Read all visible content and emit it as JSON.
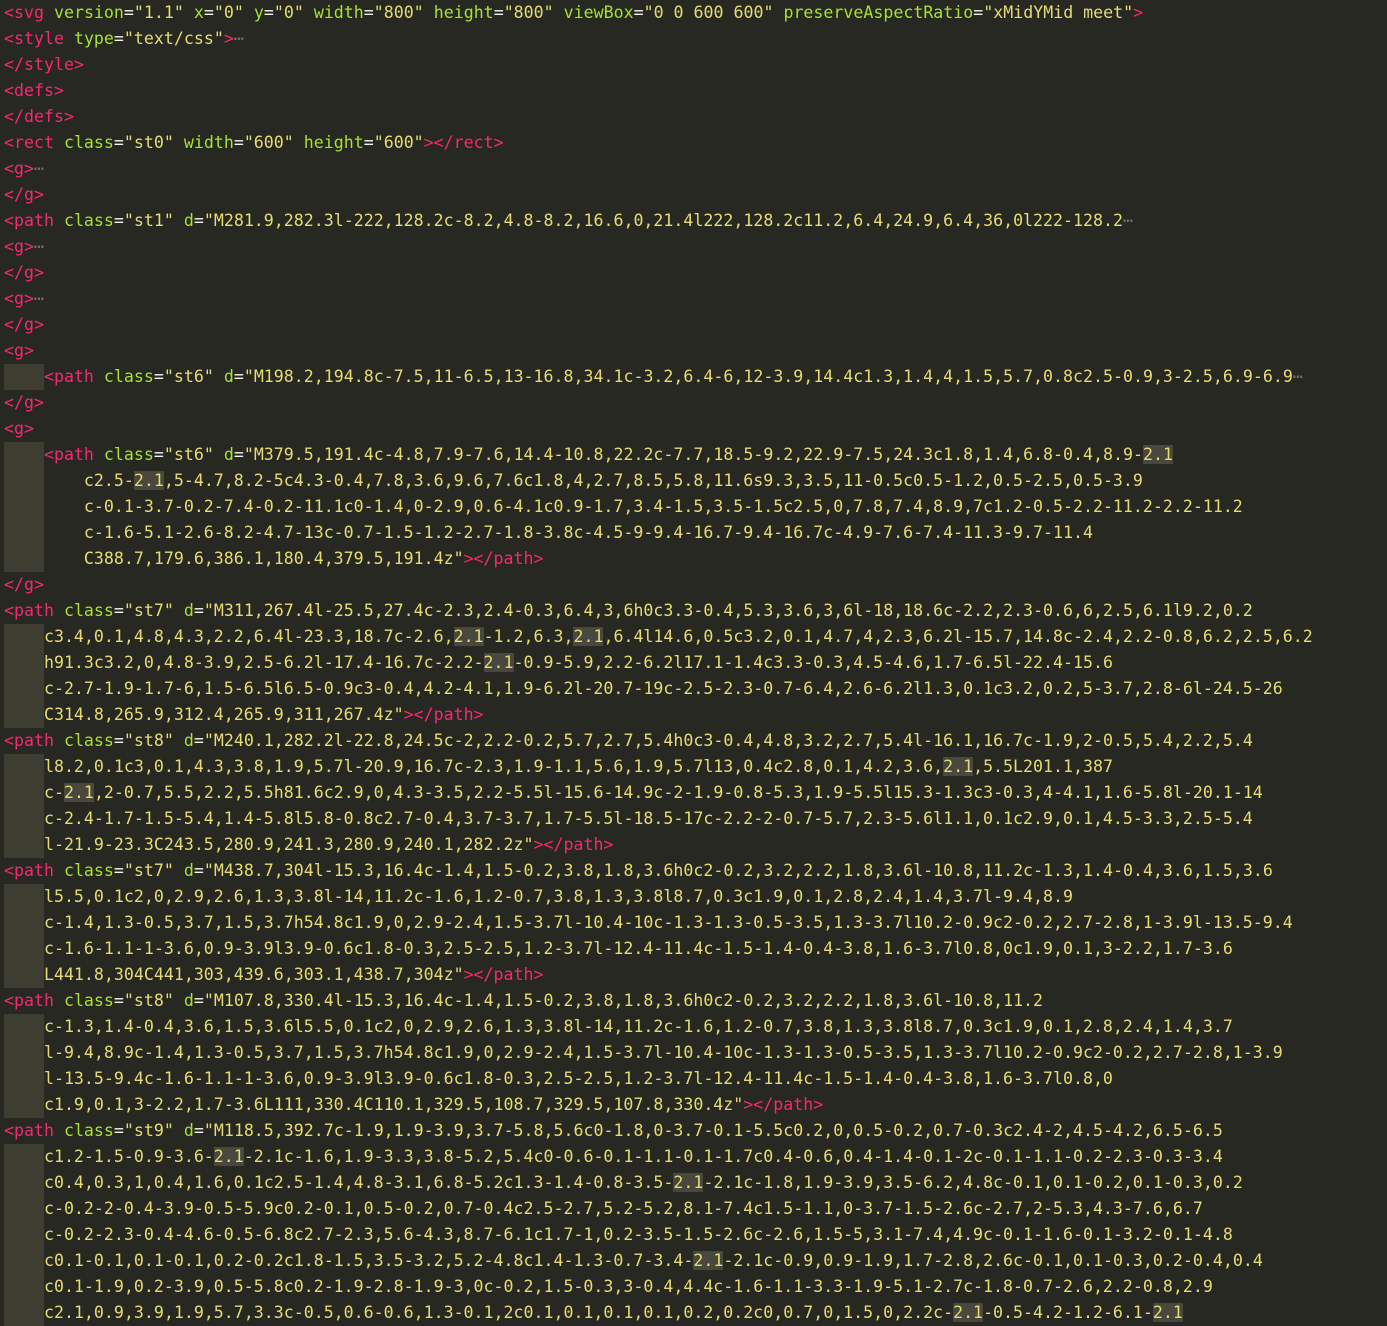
{
  "editor": {
    "lines": [
      [
        [
          "t",
          "<svg"
        ],
        [
          "p",
          " "
        ],
        [
          "a",
          "version"
        ],
        [
          "p",
          "="
        ],
        [
          "s",
          "\"1.1\""
        ],
        [
          "p",
          " "
        ],
        [
          "a",
          "x"
        ],
        [
          "p",
          "="
        ],
        [
          "s",
          "\"0\""
        ],
        [
          "p",
          " "
        ],
        [
          "a",
          "y"
        ],
        [
          "p",
          "="
        ],
        [
          "s",
          "\"0\""
        ],
        [
          "p",
          " "
        ],
        [
          "a",
          "width"
        ],
        [
          "p",
          "="
        ],
        [
          "s",
          "\"800\""
        ],
        [
          "p",
          " "
        ],
        [
          "a",
          "height"
        ],
        [
          "p",
          "="
        ],
        [
          "s",
          "\"800\""
        ],
        [
          "p",
          " "
        ],
        [
          "a",
          "viewBox"
        ],
        [
          "p",
          "="
        ],
        [
          "s",
          "\"0 0 600 600\""
        ],
        [
          "p",
          " "
        ],
        [
          "a",
          "preserveAspectRatio"
        ],
        [
          "p",
          "="
        ],
        [
          "s",
          "\"xMidYMid meet\""
        ],
        [
          "t",
          ">"
        ]
      ],
      [
        [
          "t",
          "<style"
        ],
        [
          "p",
          " "
        ],
        [
          "a",
          "type"
        ],
        [
          "p",
          "="
        ],
        [
          "s",
          "\"text/css\""
        ],
        [
          "t",
          ">"
        ],
        [
          "f",
          "⋯"
        ]
      ],
      [
        [
          "t",
          "</style>"
        ]
      ],
      [
        [
          "t",
          "<defs>"
        ]
      ],
      [
        [
          "t",
          "</defs>"
        ]
      ],
      [
        [
          "t",
          "<rect"
        ],
        [
          "p",
          " "
        ],
        [
          "a",
          "class"
        ],
        [
          "p",
          "="
        ],
        [
          "s",
          "\"st0\""
        ],
        [
          "p",
          " "
        ],
        [
          "a",
          "width"
        ],
        [
          "p",
          "="
        ],
        [
          "s",
          "\"600\""
        ],
        [
          "p",
          " "
        ],
        [
          "a",
          "height"
        ],
        [
          "p",
          "="
        ],
        [
          "s",
          "\"600\""
        ],
        [
          "t",
          "></rect>"
        ]
      ],
      [
        [
          "t",
          "<g>"
        ],
        [
          "f",
          "⋯"
        ]
      ],
      [
        [
          "t",
          "</g>"
        ]
      ],
      [
        [
          "t",
          "<path"
        ],
        [
          "p",
          " "
        ],
        [
          "a",
          "class"
        ],
        [
          "p",
          "="
        ],
        [
          "s",
          "\"st1\""
        ],
        [
          "p",
          " "
        ],
        [
          "a",
          "d"
        ],
        [
          "p",
          "="
        ],
        [
          "s",
          "\"M281.9,282.3l-222,128.2c-8.2,4.8-8.2,16.6,0,21.4l222,128.2c11.2,6.4,24.9,6.4,36,0l222-128.2"
        ],
        [
          "f",
          "⋯"
        ]
      ],
      [
        [
          "t",
          "<g>"
        ],
        [
          "f",
          "⋯"
        ]
      ],
      [
        [
          "t",
          "</g>"
        ]
      ],
      [
        [
          "t",
          "<g>"
        ],
        [
          "f",
          "⋯"
        ]
      ],
      [
        [
          "t",
          "</g>"
        ]
      ],
      [
        [
          "t",
          "<g>"
        ]
      ],
      [
        [
          "p",
          "    "
        ],
        [
          "t",
          "<path"
        ],
        [
          "p",
          " "
        ],
        [
          "a",
          "class"
        ],
        [
          "p",
          "="
        ],
        [
          "s",
          "\"st6\""
        ],
        [
          "p",
          " "
        ],
        [
          "a",
          "d"
        ],
        [
          "p",
          "="
        ],
        [
          "s",
          "\"M198.2,194.8c-7.5,11-6.5,13-16.8,34.1c-3.2,6.4-6,12-3.9,14.4c1.3,1.4,4,1.5,5.7,0.8c2.5-0.9,3-2.5,6.9-6.9"
        ],
        [
          "f",
          "⋯"
        ]
      ],
      [
        [
          "t",
          "</g>"
        ]
      ],
      [
        [
          "t",
          "<g>"
        ]
      ],
      [
        [
          "p",
          "    "
        ],
        [
          "t",
          "<path"
        ],
        [
          "p",
          " "
        ],
        [
          "a",
          "class"
        ],
        [
          "p",
          "="
        ],
        [
          "s",
          "\"st6\""
        ],
        [
          "p",
          " "
        ],
        [
          "a",
          "d"
        ],
        [
          "p",
          "="
        ],
        [
          "s",
          "\"M379.5,191.4c-4.8,7.9-7.6,14.4-10.8,22.2c-7.7,18.5-9.2,22.9-7.5,24.3c1.8,1.4,6.8-0.4,8.9-"
        ],
        [
          "h",
          "2.1"
        ]
      ],
      [
        [
          "s",
          "        c2.5-"
        ],
        [
          "h",
          "2.1"
        ],
        [
          "s",
          ",5-4.7,8.2-5c4.3-0.4,7.8,3.6,9.6,7.6c1.8,4,2.7,8.5,5.8,11.6s9.3,3.5,11-0.5c0.5-1.2,0.5-2.5,0.5-3.9"
        ]
      ],
      [
        [
          "s",
          "        c-0.1-3.7-0.2-7.4-0.2-11.1c0-1.4,0-2.9,0.6-4.1c0.9-1.7,3.4-1.5,3.5-1.5c2.5,0,7.8,7.4,8.9,7c1.2-0.5-2.2-11.2-2.2-11.2"
        ]
      ],
      [
        [
          "s",
          "        c-1.6-5.1-2.6-8.2-4.7-13c-0.7-1.5-1.2-2.7-1.8-3.8c-4.5-9-9.4-16.7-9.4-16.7c-4.9-7.6-7.4-11.3-9.7-11.4"
        ]
      ],
      [
        [
          "s",
          "        C388.7,179.6,386.1,180.4,379.5,191.4z\""
        ],
        [
          "t",
          "></path>"
        ]
      ],
      [
        [
          "t",
          "</g>"
        ]
      ],
      [
        [
          "t",
          "<path"
        ],
        [
          "p",
          " "
        ],
        [
          "a",
          "class"
        ],
        [
          "p",
          "="
        ],
        [
          "s",
          "\"st7\""
        ],
        [
          "p",
          " "
        ],
        [
          "a",
          "d"
        ],
        [
          "p",
          "="
        ],
        [
          "s",
          "\"M311,267.4l-25.5,27.4c-2.3,2.4-0.3,6.4,3,6h0c3.3-0.4,5.3,3.6,3,6l-18,18.6c-2.2,2.3-0.6,6,2.5,6.1l9.2,0.2"
        ]
      ],
      [
        [
          "s",
          "    c3.4,0.1,4.8,4.3,2.2,6.4l-23.3,18.7c-2.6,"
        ],
        [
          "h",
          "2.1"
        ],
        [
          "s",
          "-1.2,6.3,"
        ],
        [
          "h",
          "2.1"
        ],
        [
          "s",
          ",6.4l14.6,0.5c3.2,0.1,4.7,4,2.3,6.2l-15.7,14.8c-2.4,2.2-0.8,6.2,2.5,6.2"
        ]
      ],
      [
        [
          "s",
          "    h91.3c3.2,0,4.8-3.9,2.5-6.2l-17.4-16.7c-2.2-"
        ],
        [
          "h",
          "2.1"
        ],
        [
          "s",
          "-0.9-5.9,2.2-6.2l17.1-1.4c3.3-0.3,4.5-4.6,1.7-6.5l-22.4-15.6"
        ]
      ],
      [
        [
          "s",
          "    c-2.7-1.9-1.7-6,1.5-6.5l6.5-0.9c3-0.4,4.2-4.1,1.9-6.2l-20.7-19c-2.5-2.3-0.7-6.4,2.6-6.2l1.3,0.1c3.2,0.2,5-3.7,2.8-6l-24.5-26"
        ]
      ],
      [
        [
          "s",
          "    C314.8,265.9,312.4,265.9,311,267.4z\""
        ],
        [
          "t",
          "></path>"
        ]
      ],
      [
        [
          "t",
          "<path"
        ],
        [
          "p",
          " "
        ],
        [
          "a",
          "class"
        ],
        [
          "p",
          "="
        ],
        [
          "s",
          "\"st8\""
        ],
        [
          "p",
          " "
        ],
        [
          "a",
          "d"
        ],
        [
          "p",
          "="
        ],
        [
          "s",
          "\"M240.1,282.2l-22.8,24.5c-2,2.2-0.2,5.7,2.7,5.4h0c3-0.4,4.8,3.2,2.7,5.4l-16.1,16.7c-1.9,2-0.5,5.4,2.2,5.4"
        ]
      ],
      [
        [
          "s",
          "    l8.2,0.1c3,0.1,4.3,3.8,1.9,5.7l-20.9,16.7c-2.3,1.9-1.1,5.6,1.9,5.7l13,0.4c2.8,0.1,4.2,3.6,"
        ],
        [
          "h",
          "2.1"
        ],
        [
          "s",
          ",5.5L201.1,387"
        ]
      ],
      [
        [
          "s",
          "    c-"
        ],
        [
          "h",
          "2.1"
        ],
        [
          "s",
          ",2-0.7,5.5,2.2,5.5h81.6c2.9,0,4.3-3.5,2.2-5.5l-15.6-14.9c-2-1.9-0.8-5.3,1.9-5.5l15.3-1.3c3-0.3,4-4.1,1.6-5.8l-20.1-14"
        ]
      ],
      [
        [
          "s",
          "    c-2.4-1.7-1.5-5.4,1.4-5.8l5.8-0.8c2.7-0.4,3.7-3.7,1.7-5.5l-18.5-17c-2.2-2-0.7-5.7,2.3-5.6l1.1,0.1c2.9,0.1,4.5-3.3,2.5-5.4"
        ]
      ],
      [
        [
          "s",
          "    l-21.9-23.3C243.5,280.9,241.3,280.9,240.1,282.2z\""
        ],
        [
          "t",
          "></path>"
        ]
      ],
      [
        [
          "t",
          "<path"
        ],
        [
          "p",
          " "
        ],
        [
          "a",
          "class"
        ],
        [
          "p",
          "="
        ],
        [
          "s",
          "\"st7\""
        ],
        [
          "p",
          " "
        ],
        [
          "a",
          "d"
        ],
        [
          "p",
          "="
        ],
        [
          "s",
          "\"M438.7,304l-15.3,16.4c-1.4,1.5-0.2,3.8,1.8,3.6h0c2-0.2,3.2,2.2,1.8,3.6l-10.8,11.2c-1.3,1.4-0.4,3.6,1.5,3.6"
        ]
      ],
      [
        [
          "s",
          "    l5.5,0.1c2,0,2.9,2.6,1.3,3.8l-14,11.2c-1.6,1.2-0.7,3.8,1.3,3.8l8.7,0.3c1.9,0.1,2.8,2.4,1.4,3.7l-9.4,8.9"
        ]
      ],
      [
        [
          "s",
          "    c-1.4,1.3-0.5,3.7,1.5,3.7h54.8c1.9,0,2.9-2.4,1.5-3.7l-10.4-10c-1.3-1.3-0.5-3.5,1.3-3.7l10.2-0.9c2-0.2,2.7-2.8,1-3.9l-13.5-9.4"
        ]
      ],
      [
        [
          "s",
          "    c-1.6-1.1-1-3.6,0.9-3.9l3.9-0.6c1.8-0.3,2.5-2.5,1.2-3.7l-12.4-11.4c-1.5-1.4-0.4-3.8,1.6-3.7l0.8,0c1.9,0.1,3-2.2,1.7-3.6"
        ]
      ],
      [
        [
          "s",
          "    L441.8,304C441,303,439.6,303.1,438.7,304z\""
        ],
        [
          "t",
          "></path>"
        ]
      ],
      [
        [
          "t",
          "<path"
        ],
        [
          "p",
          " "
        ],
        [
          "a",
          "class"
        ],
        [
          "p",
          "="
        ],
        [
          "s",
          "\"st8\""
        ],
        [
          "p",
          " "
        ],
        [
          "a",
          "d"
        ],
        [
          "p",
          "="
        ],
        [
          "s",
          "\"M107.8,330.4l-15.3,16.4c-1.4,1.5-0.2,3.8,1.8,3.6h0c2-0.2,3.2,2.2,1.8,3.6l-10.8,11.2"
        ]
      ],
      [
        [
          "s",
          "    c-1.3,1.4-0.4,3.6,1.5,3.6l5.5,0.1c2,0,2.9,2.6,1.3,3.8l-14,11.2c-1.6,1.2-0.7,3.8,1.3,3.8l8.7,0.3c1.9,0.1,2.8,2.4,1.4,3.7"
        ]
      ],
      [
        [
          "s",
          "    l-9.4,8.9c-1.4,1.3-0.5,3.7,1.5,3.7h54.8c1.9,0,2.9-2.4,1.5-3.7l-10.4-10c-1.3-1.3-0.5-3.5,1.3-3.7l10.2-0.9c2-0.2,2.7-2.8,1-3.9"
        ]
      ],
      [
        [
          "s",
          "    l-13.5-9.4c-1.6-1.1-1-3.6,0.9-3.9l3.9-0.6c1.8-0.3,2.5-2.5,1.2-3.7l-12.4-11.4c-1.5-1.4-0.4-3.8,1.6-3.7l0.8,0"
        ]
      ],
      [
        [
          "s",
          "    c1.9,0.1,3-2.2,1.7-3.6L111,330.4C110.1,329.5,108.7,329.5,107.8,330.4z\""
        ],
        [
          "t",
          "></path>"
        ]
      ],
      [
        [
          "t",
          "<path"
        ],
        [
          "p",
          " "
        ],
        [
          "a",
          "class"
        ],
        [
          "p",
          "="
        ],
        [
          "s",
          "\"st9\""
        ],
        [
          "p",
          " "
        ],
        [
          "a",
          "d"
        ],
        [
          "p",
          "="
        ],
        [
          "s",
          "\"M118.5,392.7c-1.9,1.9-3.9,3.7-5.8,5.6c0-1.8,0-3.7-0.1-5.5c0.2,0,0.5-0.2,0.7-0.3c2.4-2,4.5-4.2,6.5-6.5"
        ]
      ],
      [
        [
          "s",
          "    c1.2-1.5-0.9-3.6-"
        ],
        [
          "h",
          "2.1"
        ],
        [
          "s",
          "-2.1c-1.6,1.9-3.3,3.8-5.2,5.4c0-0.6-0.1-1.1-0.1-1.7c0.4-0.6,0.4-1.4-0.1-2c-0.1-1.1-0.2-2.3-0.3-3.4"
        ]
      ],
      [
        [
          "s",
          "    c0.4,0.3,1,0.4,1.6,0.1c2.5-1.4,4.8-3.1,6.8-5.2c1.3-1.4-0.8-3.5-"
        ],
        [
          "h",
          "2.1"
        ],
        [
          "s",
          "-2.1c-1.8,1.9-3.9,3.5-6.2,4.8c-0.1,0.1-0.2,0.1-0.3,0.2"
        ]
      ],
      [
        [
          "s",
          "    c-0.2-2-0.4-3.9-0.5-5.9c0.2-0.1,0.5-0.2,0.7-0.4c2.5-2.7,5.2-5.2,8.1-7.4c1.5-1.1,0-3.7-1.5-2.6c-2.7,2-5.3,4.3-7.6,6.7"
        ]
      ],
      [
        [
          "s",
          "    c-0.2-2.3-0.4-4.6-0.5-6.8c2.7-2.3,5.6-4.3,8.7-6.1c1.7-1,0.2-3.5-1.5-2.6c-2.6,1.5-5,3.1-7.4,4.9c-0.1-1.6-0.1-3.2-0.1-4.8"
        ]
      ],
      [
        [
          "s",
          "    c0.1-0.1,0.1-0.1,0.2-0.2c1.8-1.5,3.5-3.2,5.2-4.8c1.4-1.3-0.7-3.4-"
        ],
        [
          "h",
          "2.1"
        ],
        [
          "s",
          "-2.1c-0.9,0.9-1.9,1.7-2.8,2.6c-0.1,0.1-0.3,0.2-0.4,0.4"
        ]
      ],
      [
        [
          "s",
          "    c0.1-1.9,0.2-3.9,0.5-5.8c0.2-1.9-2.8-1.9-3,0c-0.2,1.5-0.3,3-0.4,4.4c-1.6-1.1-3.3-1.9-5.1-2.7c-1.8-0.7-2.6,2.2-0.8,2.9"
        ]
      ],
      [
        [
          "s",
          "    c2.1,0.9,3.9,1.9,5.7,3.3c-0.5,0.6-0.6,1.3-0.1,2c0.1,0.1,0.1,0.1,0.2,0.2c0,0.7,0,1.5,0,2.2c-"
        ],
        [
          "h",
          "2.1"
        ],
        [
          "s",
          "-0.5-4.2-1.2-6.1-"
        ],
        [
          "h",
          "2.1"
        ]
      ]
    ]
  }
}
